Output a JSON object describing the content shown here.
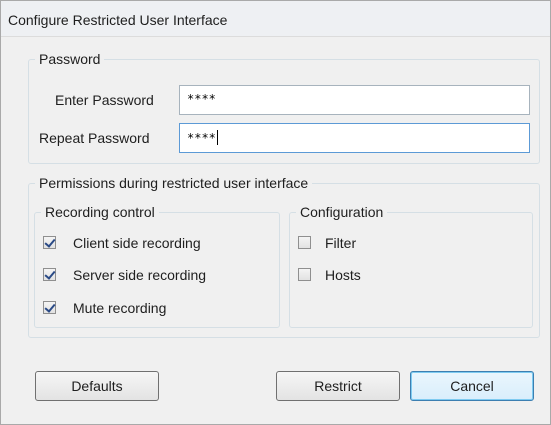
{
  "window": {
    "title": "Configure Restricted User Interface"
  },
  "password_group": {
    "legend": "Password",
    "enter_label": "Enter Password",
    "enter_value": "****",
    "repeat_label": "Repeat Password",
    "repeat_value": "****"
  },
  "permissions_group": {
    "legend": "Permissions during restricted user interface",
    "recording": {
      "legend": "Recording control",
      "items": [
        {
          "label": "Client side recording",
          "checked": true
        },
        {
          "label": "Server side recording",
          "checked": true
        },
        {
          "label": "Mute recording",
          "checked": true
        }
      ]
    },
    "configuration": {
      "legend": "Configuration",
      "items": [
        {
          "label": "Filter",
          "checked": false
        },
        {
          "label": "Hosts",
          "checked": false
        }
      ]
    }
  },
  "buttons": {
    "defaults": "Defaults",
    "restrict": "Restrict",
    "cancel": "Cancel"
  }
}
